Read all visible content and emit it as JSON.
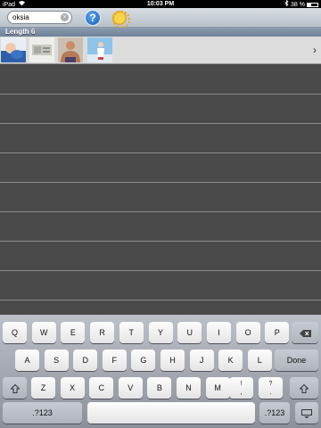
{
  "status_bar": {
    "carrier": "iPad",
    "wifi_icon": "wifi-icon",
    "time": "10:03 PM",
    "battery_percent": "38 %",
    "battery_level": 0.38,
    "bluetooth_icon": "bluetooth-icon"
  },
  "toolbar": {
    "search_value": "oksia",
    "help_label": "?",
    "light_icon": "lightbulb-icon"
  },
  "list": {
    "section_title": "Length 6",
    "row_thumbnails": [
      "baby-photo",
      "machine-photo",
      "man-photo",
      "figure-photo"
    ],
    "chevron": "›",
    "empty_rows": 8
  },
  "keyboard": {
    "row1": [
      "Q",
      "W",
      "E",
      "R",
      "T",
      "Y",
      "U",
      "I",
      "O",
      "P"
    ],
    "row2": [
      "A",
      "S",
      "D",
      "F",
      "G",
      "H",
      "J",
      "K",
      "L"
    ],
    "return_label": "Done",
    "row3": [
      "Z",
      "X",
      "C",
      "V",
      "B",
      "N",
      "M"
    ],
    "punct": [
      {
        "top": "!",
        "bottom": ","
      },
      {
        "top": "?",
        "bottom": "."
      }
    ],
    "numbers_label": ".?123",
    "backspace_icon": "backspace-icon",
    "shift_icon": "shift-icon",
    "hide_keyboard_icon": "hide-keyboard-icon"
  }
}
